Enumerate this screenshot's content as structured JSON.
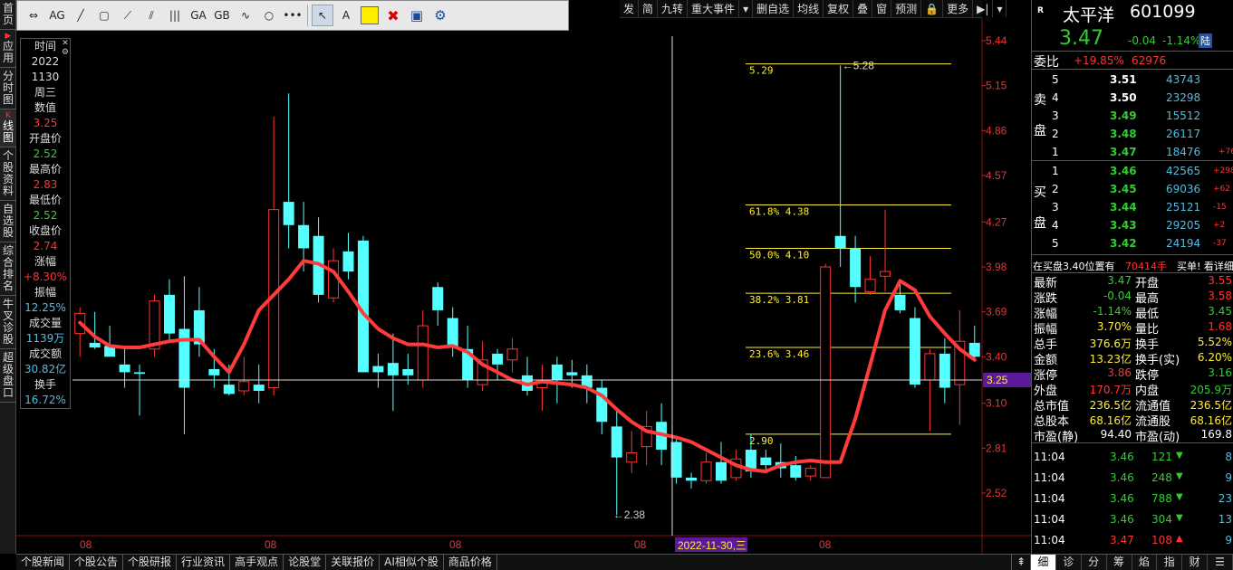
{
  "left_nav": [
    {
      "label": "首页",
      "active": false,
      "prefix": ""
    },
    {
      "label": "应用",
      "active": false,
      "prefix": "▶"
    },
    {
      "label": "分时图",
      "active": false,
      "prefix": ""
    },
    {
      "label": "线图",
      "active": true,
      "prefix": "K"
    },
    {
      "label": "个股资料",
      "active": false,
      "prefix": ""
    },
    {
      "label": "自选股",
      "active": false,
      "prefix": ""
    },
    {
      "label": "综合排名",
      "active": false,
      "prefix": ""
    },
    {
      "label": "牛叉诊股",
      "active": false,
      "prefix": ""
    },
    {
      "label": "超级盘口",
      "active": false,
      "prefix": ""
    }
  ],
  "toolbar": {
    "items": [
      "pan-icon",
      "ag-icon",
      "line-icon",
      "rect-icon",
      "fan-icon",
      "channel-icon",
      "bars-icon",
      "ga-icon",
      "gb-icon",
      "wave-icon",
      "circle-icon",
      "more-icon",
      "cursor-icon",
      "text-icon",
      "color-swatch",
      "delete-icon",
      "save-icon",
      "gear-icon"
    ],
    "text_label": "A",
    "ag_label": "AG",
    "ga_label": "GA",
    "gb_label": "GB",
    "more_label": "•••"
  },
  "top_menu": [
    "发",
    "简",
    "九转",
    "重大事件",
    "▾",
    "删自选",
    "均线",
    "复权",
    "叠",
    "窗",
    "预测",
    "🔒",
    "更多",
    "▶|",
    "▾"
  ],
  "info": {
    "time_label": "时间",
    "year": "2022",
    "date": "1130",
    "weekday": "周三",
    "value_label": "数值",
    "value": "3.25",
    "open_label": "开盘价",
    "open": "2.52",
    "high_label": "最高价",
    "high": "2.83",
    "low_label": "最低价",
    "low": "2.52",
    "close_label": "收盘价",
    "close": "2.74",
    "chg_label": "涨幅",
    "chg": "+8.30%",
    "amp_label": "振幅",
    "amp": "12.25%",
    "vol_label": "成交量",
    "vol": "1139万",
    "amt_label": "成交额",
    "amt": "30.82亿",
    "turn_label": "换手",
    "turn": "16.72%"
  },
  "chart_data": {
    "type": "candlestick",
    "y_ticks": [
      "5.44",
      "5.15",
      "4.86",
      "4.57",
      "4.27",
      "3.98",
      "3.69",
      "3.40",
      "3.10",
      "2.81",
      "2.52"
    ],
    "x_ticks": [
      "08",
      "08",
      "08",
      "08",
      "08"
    ],
    "crosshair_date": "2022-11-30,三",
    "crosshair_value": "3.25",
    "low_marker": "2.38",
    "high_marker": "5.28",
    "fib_levels": [
      {
        "label": "5.29",
        "value": 5.29
      },
      {
        "label": "61.8%  4.38",
        "value": 4.38
      },
      {
        "label": "50.0%  4.10",
        "value": 4.1
      },
      {
        "label": "38.2%  3.81",
        "value": 3.81
      },
      {
        "label": "23.6%  3.46",
        "value": 3.46
      },
      {
        "label": "2.90",
        "value": 2.9
      }
    ],
    "candles": [
      [
        3.55,
        3.72,
        3.68,
        3.4
      ],
      [
        3.49,
        3.69,
        3.46,
        3.45
      ],
      [
        3.47,
        3.6,
        3.4,
        3.44
      ],
      [
        3.35,
        3.45,
        3.3,
        3.2
      ],
      [
        3.3,
        3.35,
        3.29,
        3.02
      ],
      [
        3.45,
        3.8,
        3.76,
        3.4
      ],
      [
        3.8,
        3.9,
        3.55,
        3.5
      ],
      [
        3.58,
        3.92,
        3.2,
        2.9
      ],
      [
        3.7,
        3.85,
        3.48,
        3.4
      ],
      [
        3.32,
        3.45,
        3.28,
        3.2
      ],
      [
        3.22,
        3.35,
        3.16,
        3.15
      ],
      [
        3.18,
        3.4,
        3.24,
        3.15
      ],
      [
        3.22,
        3.35,
        3.18,
        3.1
      ],
      [
        3.2,
        4.95,
        4.35,
        3.15
      ],
      [
        4.4,
        5.1,
        4.25,
        4.1
      ],
      [
        4.25,
        4.4,
        4.1,
        3.95
      ],
      [
        4.18,
        4.3,
        3.8,
        3.75
      ],
      [
        3.78,
        4.1,
        4.02,
        3.75
      ],
      [
        4.08,
        4.2,
        3.95,
        3.9
      ],
      [
        4.15,
        4.18,
        3.3,
        3.3
      ],
      [
        3.34,
        3.42,
        3.3,
        3.2
      ],
      [
        3.36,
        3.55,
        3.28,
        3.05
      ],
      [
        3.32,
        3.42,
        3.28,
        3.22
      ],
      [
        3.25,
        3.7,
        3.6,
        3.2
      ],
      [
        3.85,
        3.88,
        3.7,
        3.6
      ],
      [
        3.65,
        3.72,
        3.46,
        3.4
      ],
      [
        3.45,
        3.6,
        3.25,
        3.2
      ],
      [
        3.22,
        3.5,
        3.38,
        3.18
      ],
      [
        3.42,
        3.45,
        3.35,
        3.25
      ],
      [
        3.38,
        3.52,
        3.45,
        3.3
      ],
      [
        3.28,
        3.4,
        3.18,
        3.15
      ],
      [
        3.2,
        3.35,
        3.25,
        3.05
      ],
      [
        3.35,
        3.4,
        3.25,
        3.1
      ],
      [
        3.3,
        3.38,
        3.28,
        3.2
      ],
      [
        3.28,
        3.35,
        3.2,
        3.1
      ],
      [
        3.2,
        3.25,
        2.98,
        2.9
      ],
      [
        2.95,
        3.05,
        2.75,
        2.38
      ],
      [
        2.72,
        2.92,
        2.78,
        2.65
      ],
      [
        2.82,
        3.05,
        2.95,
        2.7
      ],
      [
        2.98,
        3.1,
        2.8,
        2.7
      ],
      [
        2.85,
        2.88,
        2.62,
        2.58
      ],
      [
        2.62,
        2.65,
        2.6,
        2.55
      ],
      [
        2.6,
        2.78,
        2.72,
        2.58
      ],
      [
        2.72,
        2.85,
        2.6,
        2.58
      ],
      [
        2.62,
        2.8,
        2.74,
        2.6
      ],
      [
        2.8,
        2.9,
        2.66,
        2.62
      ],
      [
        2.75,
        2.8,
        2.7,
        2.66
      ],
      [
        2.72,
        2.84,
        2.68,
        2.62
      ],
      [
        2.7,
        2.76,
        2.62,
        2.6
      ],
      [
        2.63,
        2.7,
        2.68,
        2.6
      ],
      [
        2.62,
        4.0,
        3.98,
        2.62
      ],
      [
        4.18,
        5.28,
        4.1,
        3.98
      ],
      [
        4.1,
        4.18,
        3.85,
        3.75
      ],
      [
        3.82,
        4.05,
        3.9,
        3.8
      ],
      [
        3.92,
        4.35,
        3.95,
        3.82
      ],
      [
        3.8,
        3.9,
        3.7,
        3.68
      ],
      [
        3.65,
        3.72,
        3.22,
        3.2
      ],
      [
        3.25,
        3.45,
        3.42,
        2.92
      ],
      [
        3.42,
        3.52,
        3.2,
        3.1
      ],
      [
        3.22,
        3.7,
        3.5,
        2.96
      ],
      [
        3.49,
        3.6,
        3.4,
        3.38
      ]
    ],
    "ma": [
      3.62,
      3.53,
      3.47,
      3.46,
      3.46,
      3.48,
      3.5,
      3.51,
      3.51,
      3.4,
      3.3,
      3.48,
      3.7,
      3.8,
      3.9,
      4.02,
      4.0,
      3.95,
      3.82,
      3.68,
      3.58,
      3.52,
      3.48,
      3.48,
      3.46,
      3.47,
      3.43,
      3.35,
      3.3,
      3.25,
      3.22,
      3.24,
      3.23,
      3.22,
      3.2,
      3.15,
      3.06,
      2.98,
      2.92,
      2.9,
      2.88,
      2.85,
      2.8,
      2.75,
      2.7,
      2.67,
      2.66,
      2.7,
      2.72,
      2.73,
      2.72,
      2.72,
      3.0,
      3.35,
      3.7,
      3.89,
      3.83,
      3.66,
      3.55,
      3.45,
      3.38
    ]
  },
  "quote": {
    "r_label": "R",
    "name": "太平洋",
    "code": "601099",
    "price": "3.47",
    "chg": "-0.04",
    "pct": "-1.14%",
    "lu": "陆",
    "weibi_label": "委比",
    "weibi": "+19.85%",
    "weicha": "62976",
    "sell_label_1": "卖",
    "sell_label_2": "盘",
    "buy_label_1": "买",
    "buy_label_2": "盘",
    "sells": [
      {
        "lvl": "5",
        "p": "3.51",
        "v": "43743",
        "d": ""
      },
      {
        "lvl": "4",
        "p": "3.50",
        "v": "23298",
        "d": ""
      },
      {
        "lvl": "3",
        "p": "3.49",
        "v": "15512",
        "d": ""
      },
      {
        "lvl": "2",
        "p": "3.48",
        "v": "26117",
        "d": ""
      },
      {
        "lvl": "1",
        "p": "3.47",
        "v": "18476",
        "d": "+76"
      }
    ],
    "buys": [
      {
        "lvl": "1",
        "p": "3.46",
        "v": "42565",
        "d": "+298"
      },
      {
        "lvl": "2",
        "p": "3.45",
        "v": "69036",
        "d": "+62"
      },
      {
        "lvl": "3",
        "p": "3.44",
        "v": "25121",
        "d": "-15"
      },
      {
        "lvl": "4",
        "p": "3.43",
        "v": "29205",
        "d": "+2"
      },
      {
        "lvl": "5",
        "p": "3.42",
        "v": "24194",
        "d": "-37"
      }
    ],
    "notice": "在买盘3.40位置有",
    "notice_vol": "70414手",
    "notice_tail": "买单! 看详细",
    "stats": [
      [
        "最新",
        "3.47",
        "green",
        "开盘",
        "3.55",
        "red"
      ],
      [
        "涨跌",
        "-0.04",
        "green",
        "最高",
        "3.58",
        "red"
      ],
      [
        "涨幅",
        "-1.14%",
        "green",
        "最低",
        "3.45",
        "green"
      ],
      [
        "振幅",
        "3.70%",
        "yellow",
        "量比",
        "1.68",
        "red"
      ],
      [
        "总手",
        "376.6万",
        "yellow",
        "换手",
        "5.52%",
        "yellow"
      ],
      [
        "金额",
        "13.23亿",
        "yellow",
        "换手(实)",
        "6.20%",
        "yellow"
      ],
      [
        "涨停",
        "3.86",
        "red",
        "跌停",
        "3.16",
        "green"
      ],
      [
        "外盘",
        "170.7万",
        "red",
        "内盘",
        "205.9万",
        "green"
      ],
      [
        "总市值",
        "236.5亿",
        "yellow",
        "流通值",
        "236.5亿",
        "yellow"
      ],
      [
        "总股本",
        "68.16亿",
        "yellow",
        "流通股",
        "68.16亿",
        "yellow"
      ],
      [
        "市盈(静)",
        "94.40",
        "white",
        "市盈(动)",
        "169.8",
        "white"
      ]
    ],
    "ticks": [
      {
        "t": "11:04",
        "p": "3.46",
        "v": "121",
        "dir": "down",
        "n": "8"
      },
      {
        "t": "11:04",
        "p": "3.46",
        "v": "248",
        "dir": "down",
        "n": "9"
      },
      {
        "t": "11:04",
        "p": "3.46",
        "v": "788",
        "dir": "down",
        "n": "23"
      },
      {
        "t": "11:04",
        "p": "3.46",
        "v": "304",
        "dir": "down",
        "n": "13"
      },
      {
        "t": "11:04",
        "p": "3.47",
        "v": "108",
        "dir": "up",
        "n": "9"
      }
    ]
  },
  "bottom_tabs": [
    "个股新闻",
    "个股公告",
    "个股研报",
    "行业资讯",
    "高手观点",
    "论股堂",
    "关联报价",
    "AI相似个股",
    "商品价格"
  ],
  "bottom_tab_icon": "⇞",
  "bottom_right_tabs": [
    "细",
    "诊",
    "分",
    "筹",
    "焰",
    "指",
    "财",
    "☰"
  ]
}
